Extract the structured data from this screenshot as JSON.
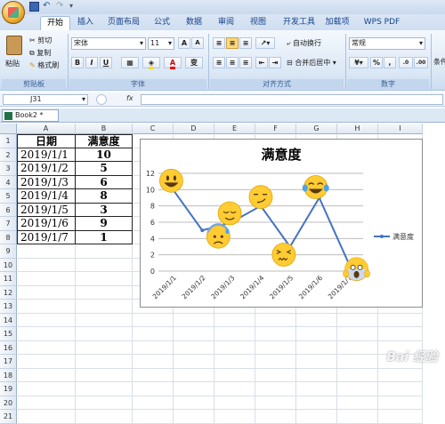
{
  "quick_access": [
    "save",
    "undo",
    "redo",
    "customize"
  ],
  "tabs": [
    {
      "label": "开始",
      "active": true
    },
    {
      "label": "插入"
    },
    {
      "label": "页面布局"
    },
    {
      "label": "公式"
    },
    {
      "label": "数据"
    },
    {
      "label": "审阅"
    },
    {
      "label": "视图"
    },
    {
      "label": "开发工具"
    },
    {
      "label": "加载项"
    },
    {
      "label": "WPS PDF"
    }
  ],
  "ribbon": {
    "clipboard": {
      "paste": "粘贴",
      "cut": "剪切",
      "copy": "复制",
      "format_painter": "格式刷",
      "label": "剪贴板"
    },
    "font": {
      "name": "宋体",
      "size": "11",
      "bold": "B",
      "italic": "I",
      "underline": "U",
      "wen": "变",
      "label": "字体",
      "grow": "A",
      "shrink": "A"
    },
    "alignment": {
      "wrap": "自动换行",
      "merge": "合并后居中",
      "label": "对齐方式"
    },
    "number": {
      "format": "常规",
      "percent": "%",
      "comma": ",",
      "label": "数字"
    },
    "styles": {
      "cond": "条件"
    }
  },
  "formula_bar": {
    "name_box": "J31",
    "fx": "fx"
  },
  "workbook_tab": "Book2 *",
  "columns": [
    "A",
    "B",
    "C",
    "D",
    "E",
    "F",
    "G",
    "H",
    "I"
  ],
  "rows": [
    "1",
    "2",
    "3",
    "4",
    "5",
    "6",
    "7",
    "8",
    "9",
    "10",
    "11",
    "12",
    "13",
    "14",
    "15",
    "16",
    "17",
    "18",
    "19",
    "20",
    "21"
  ],
  "table": {
    "headers": [
      "日期",
      "满意度"
    ],
    "rows": [
      [
        "2019/1/1",
        "10"
      ],
      [
        "2019/1/2",
        "5"
      ],
      [
        "2019/1/3",
        "6"
      ],
      [
        "2019/1/4",
        "8"
      ],
      [
        "2019/1/5",
        "3"
      ],
      [
        "2019/1/6",
        "9"
      ],
      [
        "2019/1/7",
        "1"
      ]
    ]
  },
  "chart_data": {
    "type": "line",
    "title": "满意度",
    "categories": [
      "2019/1/1",
      "2019/1/2",
      "2019/1/3",
      "2019/1/4",
      "2019/1/5",
      "2019/1/6",
      "2019/1/7"
    ],
    "series": [
      {
        "name": "满意度",
        "values": [
          10,
          5,
          6,
          8,
          3,
          9,
          1
        ],
        "color": "#4472c4"
      }
    ],
    "ylim": [
      0,
      12
    ],
    "yticks": [
      "0",
      "2",
      "4",
      "6",
      "8",
      "10",
      "12"
    ],
    "grid": true,
    "legend": "right",
    "markers": [
      "grinning-emoji",
      "anxious-sweat-emoji",
      "relieved-emoji",
      "smirk-emoji",
      "confounded-emoji",
      "tears-of-joy-emoji",
      "screaming-emoji"
    ]
  },
  "watermark": "Bai 经验"
}
